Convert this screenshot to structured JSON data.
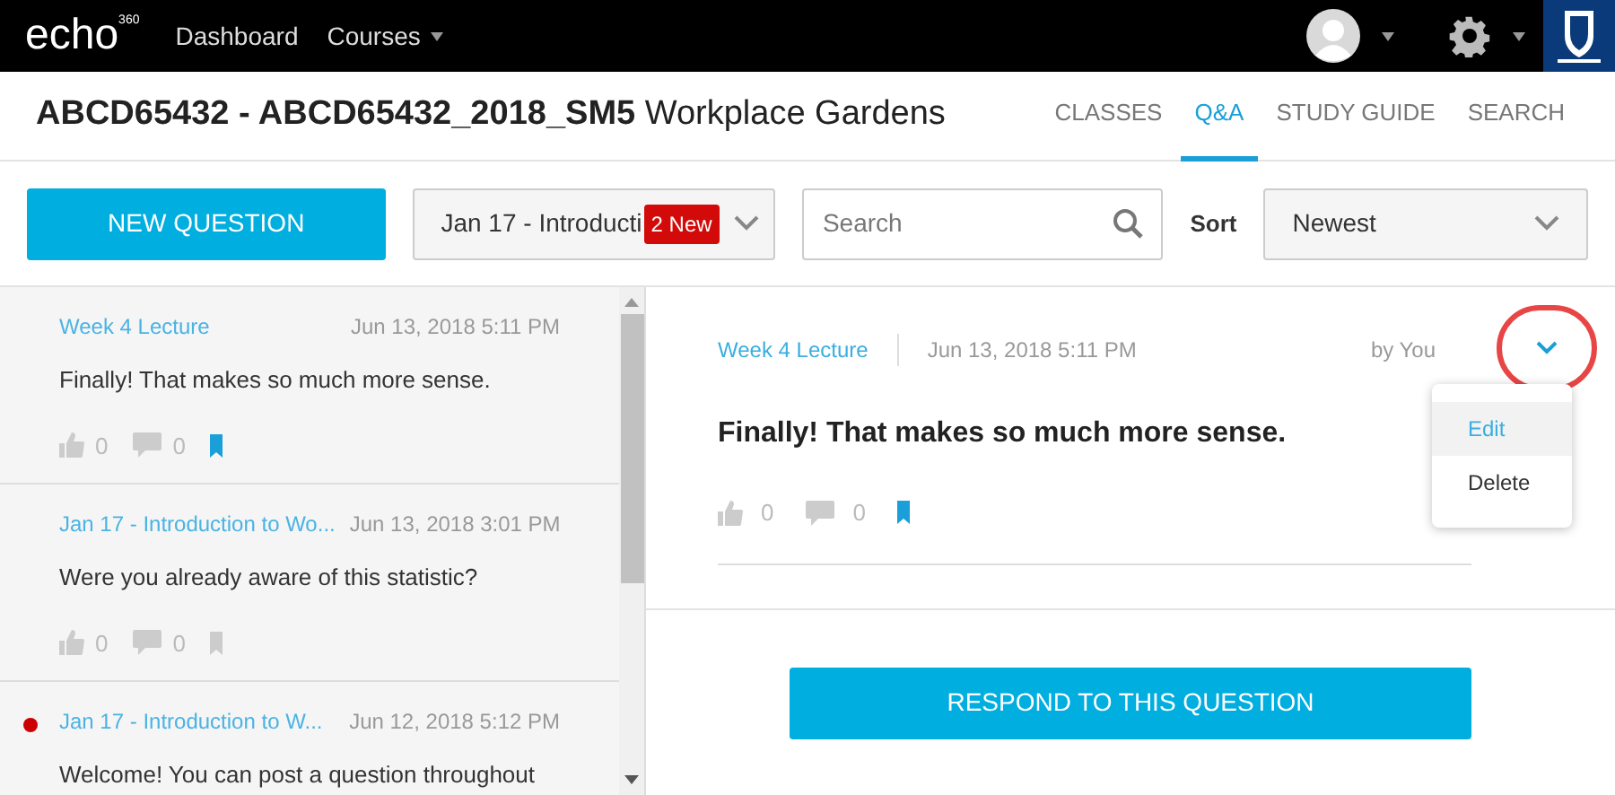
{
  "top_nav": {
    "logo": "echo",
    "logo_sup": "360",
    "links": [
      {
        "label": "Dashboard",
        "has_caret": false
      },
      {
        "label": "Courses",
        "has_caret": true
      }
    ]
  },
  "course": {
    "code": "ABCD65432 - ABCD65432_2018_SM5",
    "name": "Workplace Gardens"
  },
  "tabs": [
    {
      "label": "CLASSES",
      "selected": false
    },
    {
      "label": "Q&A",
      "selected": true
    },
    {
      "label": "STUDY GUIDE",
      "selected": false
    },
    {
      "label": "SEARCH",
      "selected": false
    }
  ],
  "toolbar": {
    "new_button": "NEW QUESTION",
    "class_filter": {
      "value": "Jan 17 - Introducti",
      "badge": "2 New"
    },
    "search": {
      "placeholder": "Search"
    },
    "sort_label": "Sort",
    "sort": {
      "value": "Newest"
    }
  },
  "questions": [
    {
      "lesson": "Week 4 Lecture",
      "date": "Jun 13, 2018 5:11 PM",
      "text": "Finally! That makes so much more sense.",
      "likes": "0",
      "replies": "0",
      "bookmarked": true,
      "unread": false
    },
    {
      "lesson": "Jan 17 - Introduction to Wo...",
      "date": "Jun 13, 2018 3:01 PM",
      "text": "Were you already aware of this statistic?",
      "likes": "0",
      "replies": "0",
      "bookmarked": false,
      "unread": false
    },
    {
      "lesson": "Jan 17 - Introduction to W...",
      "date": "Jun 12, 2018 5:12 PM",
      "text": "Welcome! You can post a question throughout",
      "unread": true
    }
  ],
  "detail": {
    "lesson": "Week 4 Lecture",
    "date": "Jun 13, 2018 5:11 PM",
    "author": "by You",
    "text": "Finally! That makes so much more sense.",
    "likes": "0",
    "replies": "0",
    "bookmarked": true,
    "menu": [
      {
        "label": "Edit",
        "selected": true
      },
      {
        "label": "Delete",
        "selected": false
      }
    ],
    "respond_button": "RESPOND TO THIS QUESTION"
  }
}
